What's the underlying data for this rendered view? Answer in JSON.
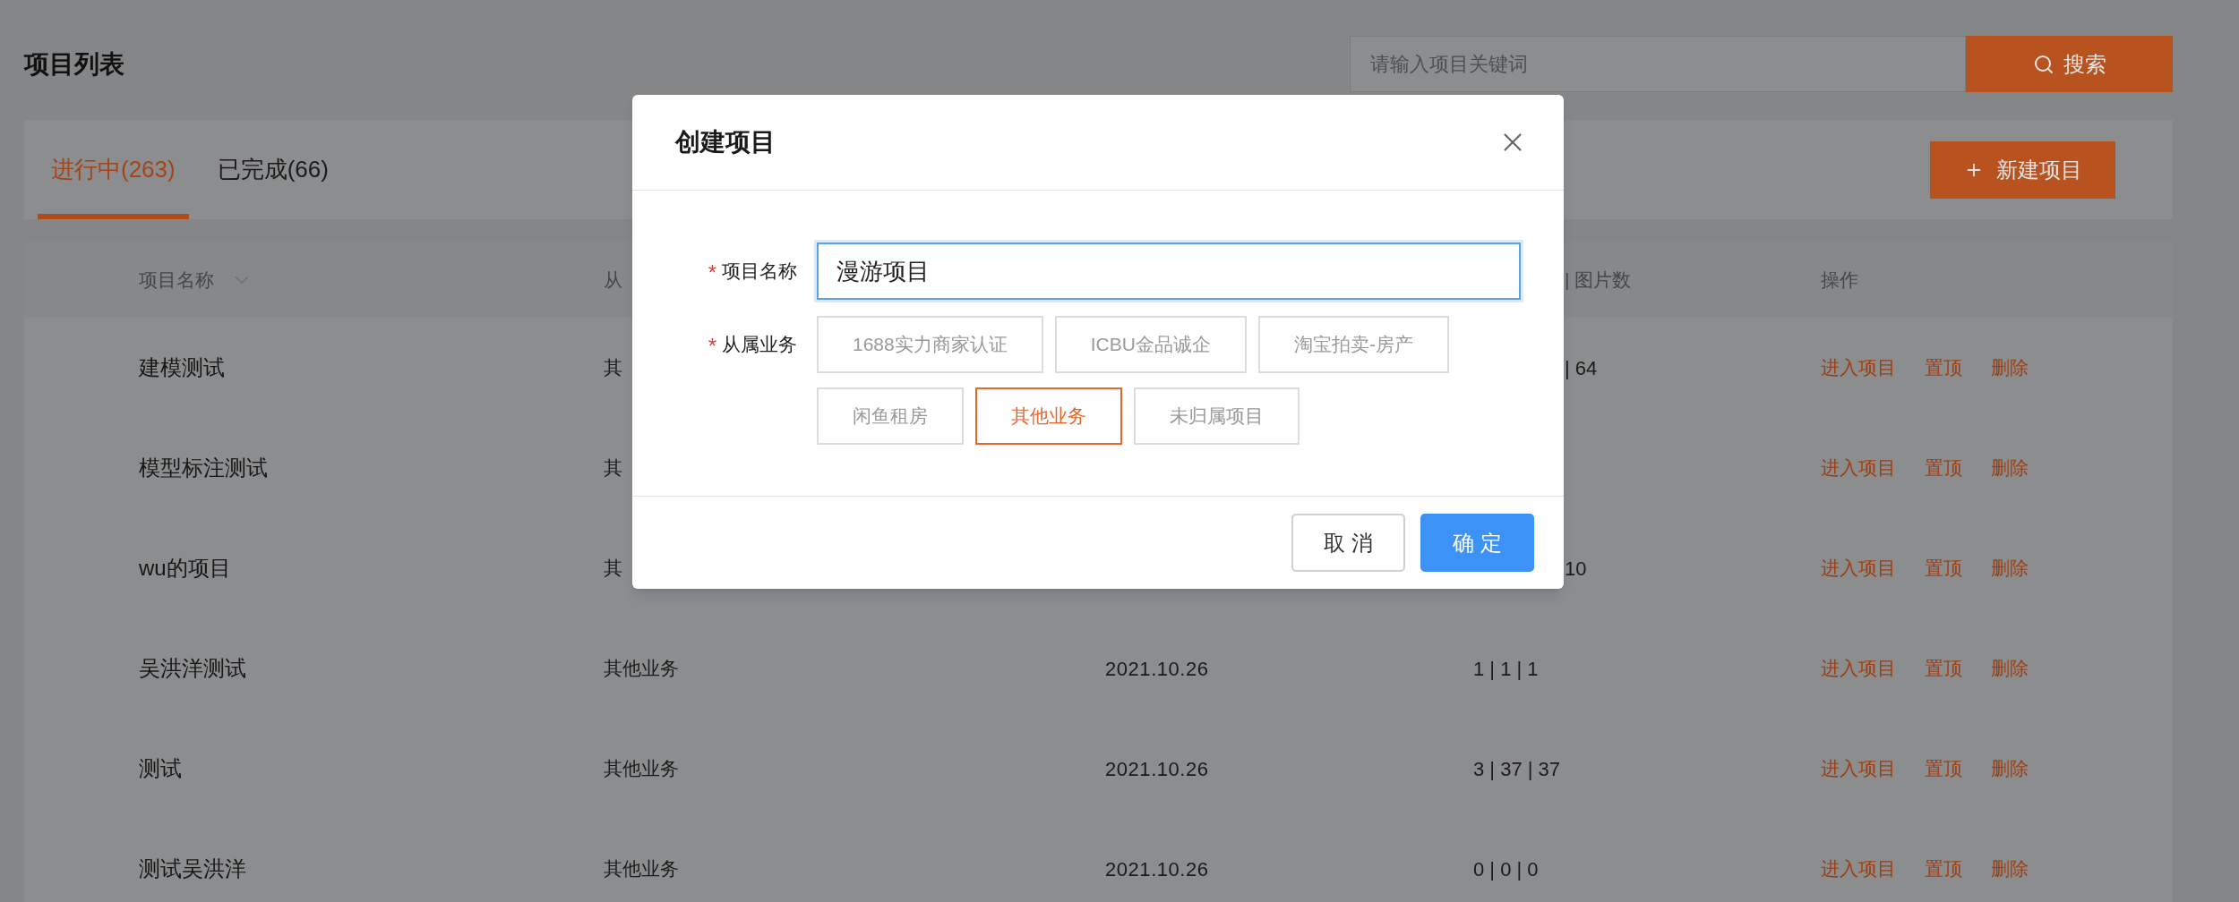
{
  "page_title": "项目列表",
  "search": {
    "placeholder": "请输入项目关键词",
    "button": "搜索"
  },
  "tabs": [
    {
      "label": "进行中(263)",
      "selected": true
    },
    {
      "label": "已完成(66)",
      "selected": false
    }
  ],
  "new_button": "新建项目",
  "table": {
    "header": {
      "name": "项目名称",
      "business": "从",
      "counts": "| 图片数",
      "counts_clipped": true,
      "actions": "操作"
    },
    "rows": [
      {
        "name": "建模测试",
        "business": "其",
        "counts": "| 64",
        "counts_clipped": true,
        "actions": [
          "进入项目",
          "置顶",
          "删除"
        ]
      },
      {
        "name": "模型标注测试",
        "business": "其",
        "actions": [
          "进入项目",
          "置顶",
          "删除"
        ]
      },
      {
        "name": "wu的项目",
        "business": "其",
        "counts": "10",
        "counts_clipped": true,
        "actions": [
          "进入项目",
          "置顶",
          "删除"
        ]
      },
      {
        "name": "吴洪洋测试",
        "business": "其他业务",
        "date": "2021.10.26",
        "counts": "1 | 1 | 1",
        "actions": [
          "进入项目",
          "置顶",
          "删除"
        ]
      },
      {
        "name": "测试",
        "business": "其他业务",
        "date": "2021.10.26",
        "counts": "3 | 37 | 37",
        "actions": [
          "进入项目",
          "置顶",
          "删除"
        ]
      },
      {
        "name": "测试吴洪洋",
        "business": "其他业务",
        "date": "2021.10.26",
        "counts": "0 | 0 | 0",
        "actions": [
          "进入项目",
          "置顶",
          "删除"
        ]
      }
    ]
  },
  "dialog": {
    "title": "创建项目",
    "fields": [
      {
        "label": "项目名称",
        "required_mark": "*",
        "kind": "text",
        "value": "漫游项目"
      },
      {
        "label": "从属业务",
        "required_mark": "*",
        "kind": "tags",
        "options": [
          {
            "label": "1688实力商家认证",
            "selected": false
          },
          {
            "label": "ICBU金品诚企",
            "selected": false
          },
          {
            "label": "淘宝拍卖-房产",
            "selected": false
          },
          {
            "label": "闲鱼租房",
            "selected": false
          },
          {
            "label": "其他业务",
            "selected": true
          },
          {
            "label": "未归属项目",
            "selected": false
          }
        ]
      }
    ],
    "buttons": [
      {
        "label": "取 消",
        "kind": "secondary"
      },
      {
        "label": "确 定",
        "kind": "primary"
      }
    ]
  }
}
